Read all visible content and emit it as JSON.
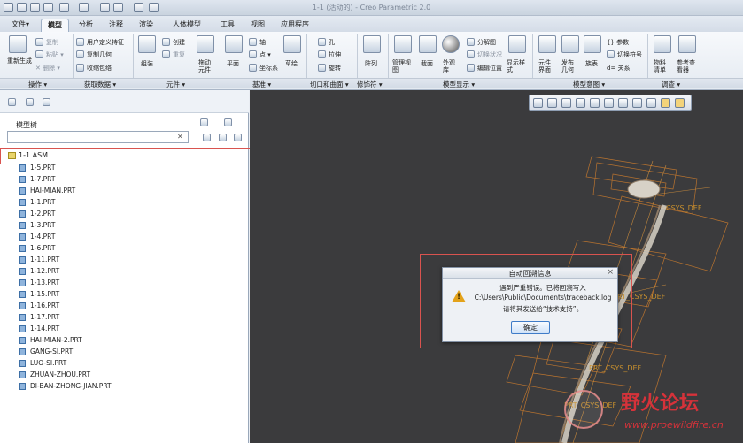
{
  "window": {
    "title": "1-1 (活动的) - Creo Parametric 2.0"
  },
  "menu_tabs": [
    {
      "label": "文件▾",
      "active": false
    },
    {
      "label": "模型",
      "active": true
    },
    {
      "label": "分析",
      "active": false
    },
    {
      "label": "注释",
      "active": false
    },
    {
      "label": "渲染",
      "active": false
    },
    {
      "label": "人体模型",
      "active": false
    },
    {
      "label": "工具",
      "active": false
    },
    {
      "label": "视图",
      "active": false
    },
    {
      "label": "应用程序",
      "active": false
    }
  ],
  "ribbon": {
    "operations": {
      "regenerate": "重新生成",
      "copy": "复制",
      "paste": "粘贴 ▾",
      "delete": "✕ 删除 ▾",
      "group": "操作 ▾"
    },
    "get_data": {
      "udf": "用户定义特征",
      "copy_geom": "复制几何",
      "shrinkwrap": "收缩包络",
      "group": "获取数据 ▾"
    },
    "component": {
      "assemble": "组装",
      "create": "创建",
      "repeat": "重复",
      "drag": "拖动元件",
      "group": "元件 ▾"
    },
    "datum": {
      "plane": "平面",
      "axis": "轴",
      "point": "点 ▾",
      "csys": "坐标系",
      "sketch": "草绘",
      "group": "基准 ▾"
    },
    "cut_surface": {
      "hole": "孔",
      "extrude": "拉伸",
      "revolve": "旋转",
      "group": "切口和曲面 ▾"
    },
    "modifiers": {
      "pattern": "阵列",
      "group": "修饰符 ▾"
    },
    "model_display": {
      "manage_views": "管理视图",
      "section": "截面",
      "appearance": "外观库",
      "explode": "分解图",
      "toggle_status": "切换状况",
      "edit_position": "编辑位置",
      "display_style": "显示样式",
      "group": "模型显示 ▾"
    },
    "model_intent": {
      "family_table": "元件界面",
      "publish_geom": "发布几何",
      "family": "族表",
      "params": "{} 参数",
      "switch_symbols": "切换符号",
      "relations": "d= 关系",
      "group": "模型意图 ▾"
    },
    "investigate": {
      "bom": "物料清单",
      "ref_viewer": "参考查看器",
      "group": "调查 ▾"
    }
  },
  "model_tree": {
    "title": "模型树",
    "filter_clear": "✕",
    "root": "1-1.ASM",
    "items": [
      "1-5.PRT",
      "1-7.PRT",
      "HAI-MIAN.PRT",
      "1-1.PRT",
      "1-2.PRT",
      "1-3.PRT",
      "1-4.PRT",
      "1-6.PRT",
      "1-11.PRT",
      "1-12.PRT",
      "1-13.PRT",
      "1-15.PRT",
      "1-16.PRT",
      "1-17.PRT",
      "1-14.PRT",
      "HAI-MIAN-2.PRT",
      "GANG-SI.PRT",
      "LUO-SI.PRT",
      "ZHUAN-ZHOU.PRT",
      "DI-BAN-ZHONG-JIAN.PRT"
    ]
  },
  "graphics": {
    "csys_labels": [
      "CSYS_DEF",
      "RT_CSYS_DEF",
      "PRT_CSYS_DEF",
      "PRT_CSYS_DEF"
    ]
  },
  "dialog": {
    "title": "自动回溯信息",
    "close": "×",
    "line1": "遇到严重错误。已将回溯写入",
    "line2": "C:\\Users\\Public\\Documents\\traceback.log",
    "line3": "请将其发送给“技术支持”。",
    "ok": "确定"
  },
  "watermark": {
    "title": "野火论坛",
    "url": "www.proewildfire.cn"
  }
}
